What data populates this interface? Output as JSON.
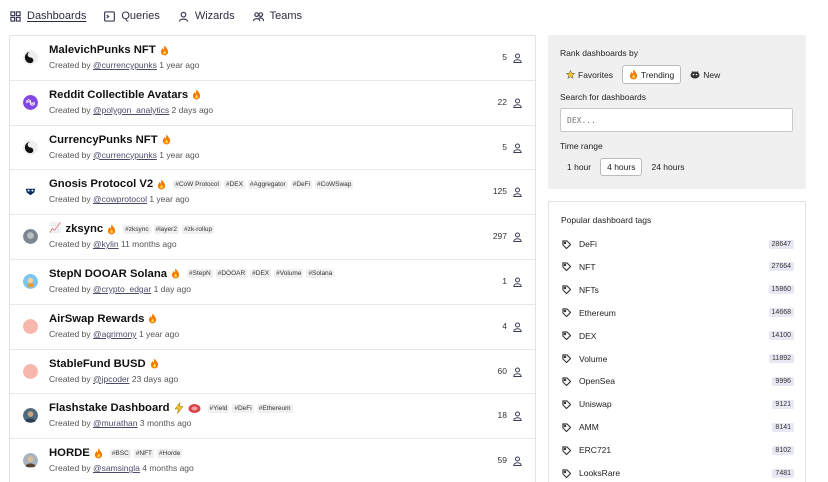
{
  "nav": [
    {
      "label": "Dashboards",
      "icon": "dashboards-icon",
      "active": true
    },
    {
      "label": "Queries",
      "icon": "terminal-icon"
    },
    {
      "label": "Wizards",
      "icon": "wizard-icon"
    },
    {
      "label": "Teams",
      "icon": "teams-icon"
    }
  ],
  "dashboards": [
    {
      "title": "MalevichPunks NFT",
      "badges": [
        "flame"
      ],
      "tags": [],
      "created_prefix": "Created by",
      "user": "@currencypunks",
      "time": "1 year ago",
      "stars": "5",
      "avatar": "yin"
    },
    {
      "title": "Reddit Collectible Avatars",
      "badges": [
        "flame"
      ],
      "tags": [],
      "created_prefix": "Created by",
      "user": "@polygon_analytics",
      "time": "2 days ago",
      "stars": "22",
      "avatar": "polygon"
    },
    {
      "title": "CurrencyPunks NFT",
      "badges": [
        "flame"
      ],
      "tags": [],
      "created_prefix": "Created by",
      "user": "@currencypunks",
      "time": "1 year ago",
      "stars": "5",
      "avatar": "yin"
    },
    {
      "title": "Gnosis Protocol V2",
      "badges": [
        "flame"
      ],
      "tags": [
        "#CoW Protocol",
        "#DEX",
        "#Aggregator",
        "#DeFi",
        "#CoWSwap"
      ],
      "created_prefix": "Created by",
      "user": "@cowprotocol",
      "time": "1 year ago",
      "stars": "125",
      "avatar": "cow"
    },
    {
      "title": "zksync",
      "badges": [
        "flame"
      ],
      "tags": [
        "#zksync",
        "#layer2",
        "#zk-rollup"
      ],
      "created_prefix": "Created by",
      "user": "@kylin",
      "time": "11 months ago",
      "stars": "297",
      "avatar": "gray",
      "prefix_emoji": "📈"
    },
    {
      "title": "StepN DOOAR Solana",
      "badges": [
        "flame"
      ],
      "tags": [
        "#StepN",
        "#DOOAR",
        "#DEX",
        "#Volume",
        "#Solana"
      ],
      "created_prefix": "Created by",
      "user": "@crypto_edgar",
      "time": "1 day ago",
      "stars": "1",
      "avatar": "blue"
    },
    {
      "title": "AirSwap Rewards",
      "badges": [
        "flame"
      ],
      "tags": [],
      "created_prefix": "Created by",
      "user": "@agrimony",
      "time": "1 year ago",
      "stars": "4",
      "avatar": "pink"
    },
    {
      "title": "StableFund BUSD",
      "badges": [
        "flame"
      ],
      "tags": [],
      "created_prefix": "Created by",
      "user": "@jpcoder",
      "time": "23 days ago",
      "stars": "60",
      "avatar": "pink"
    },
    {
      "title": "Flashstake Dashboard",
      "badges": [
        "zap",
        "meat"
      ],
      "tags": [
        "#Yield",
        "#DeFi",
        "#Ethereum"
      ],
      "created_prefix": "Created by",
      "user": "@murathan",
      "time": "3 months ago",
      "stars": "18",
      "avatar": "photo"
    },
    {
      "title": "HORDE",
      "badges": [
        "flame"
      ],
      "tags": [
        "#BSC",
        "#NFT",
        "#Horde"
      ],
      "created_prefix": "Created by",
      "user": "@samsingla",
      "time": "4 months ago",
      "stars": "59",
      "avatar": "photo2"
    }
  ],
  "rank": {
    "heading": "Rank dashboards by",
    "options": [
      {
        "label": "Favorites",
        "icon": "star-icon",
        "selected": false
      },
      {
        "label": "Trending",
        "icon": "flame-icon",
        "selected": true
      },
      {
        "label": "New",
        "icon": "new-icon",
        "selected": false
      }
    ],
    "search_heading": "Search for dashboards",
    "search_placeholder": "DEX...",
    "time_heading": "Time range",
    "time_options": [
      {
        "label": "1 hour",
        "selected": false
      },
      {
        "label": "4 hours",
        "selected": true
      },
      {
        "label": "24 hours",
        "selected": false
      }
    ]
  },
  "popular": {
    "heading": "Popular dashboard tags",
    "tags": [
      {
        "name": "DeFi",
        "count": "28647"
      },
      {
        "name": "NFT",
        "count": "27664"
      },
      {
        "name": "NFTs",
        "count": "15860"
      },
      {
        "name": "Ethereum",
        "count": "14668"
      },
      {
        "name": "DEX",
        "count": "14100"
      },
      {
        "name": "Volume",
        "count": "11892"
      },
      {
        "name": "OpenSea",
        "count": "9996"
      },
      {
        "name": "Uniswap",
        "count": "9121"
      },
      {
        "name": "AMM",
        "count": "8141"
      },
      {
        "name": "ERC721",
        "count": "8102"
      },
      {
        "name": "LooksRare",
        "count": "7481"
      }
    ]
  },
  "colors": {
    "accent": "#3a3d55",
    "flame": "#f57c00",
    "tag_bg": "#f0f0f0"
  }
}
